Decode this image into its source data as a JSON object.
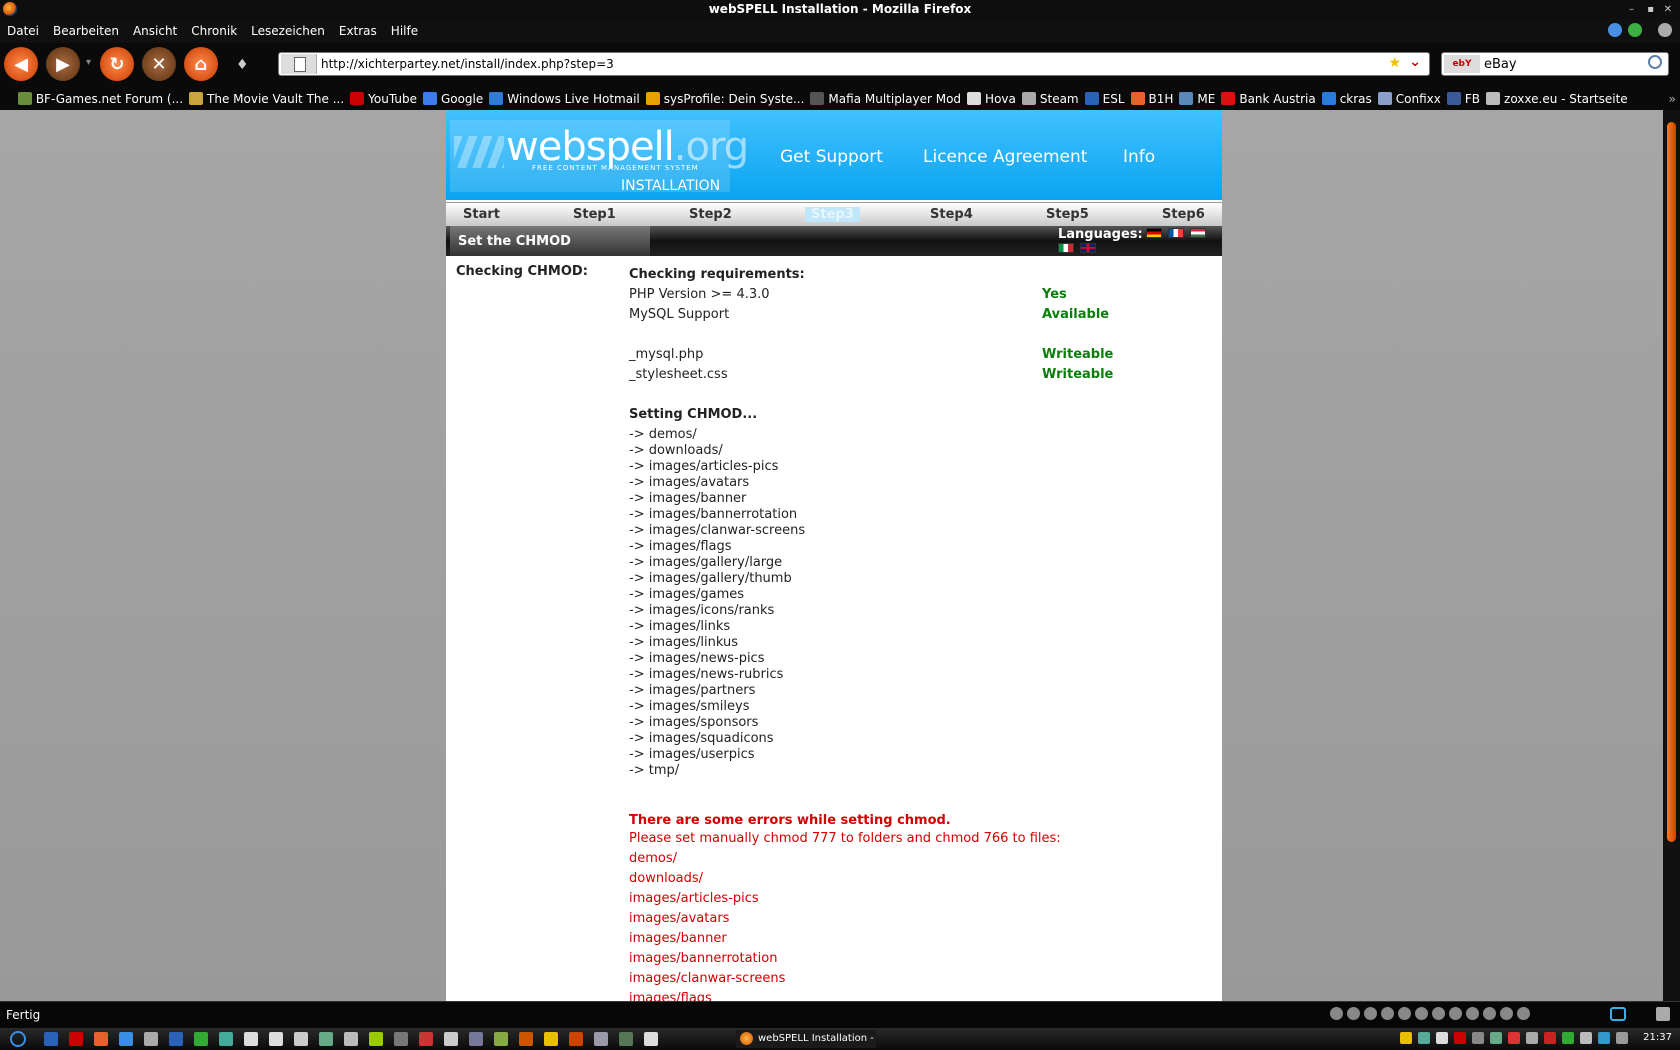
{
  "window": {
    "title": "webSPELL Installation - Mozilla Firefox"
  },
  "menu": [
    "Datei",
    "Bearbeiten",
    "Ansicht",
    "Chronik",
    "Lesezeichen",
    "Extras",
    "Hilfe"
  ],
  "toolbar": {
    "url": "http://xichterpartey.net/install/index.php?step=3",
    "search_value": "eBay",
    "search_engine": "ebY"
  },
  "bookmarks": [
    {
      "label": "BF-Games.net Forum (...",
      "color": "#6a8f3a"
    },
    {
      "label": "The Movie Vault The ...",
      "color": "#c9a53b"
    },
    {
      "label": "YouTube",
      "color": "#c00"
    },
    {
      "label": "Google",
      "color": "#3b7de9"
    },
    {
      "label": "Windows Live Hotmail",
      "color": "#2f7bd6"
    },
    {
      "label": "sysProfile: Dein Syste...",
      "color": "#e7a100"
    },
    {
      "label": "Mafia Multiplayer Mod",
      "color": "#555"
    },
    {
      "label": "Hova",
      "color": "#ddd"
    },
    {
      "label": "Steam",
      "color": "#aaa"
    },
    {
      "label": "ESL",
      "color": "#2a62b8"
    },
    {
      "label": "B1H",
      "color": "#e8602c"
    },
    {
      "label": "ME",
      "color": "#5a88b8"
    },
    {
      "label": "Bank Austria",
      "color": "#d11"
    },
    {
      "label": "ckras",
      "color": "#2a7be0"
    },
    {
      "label": "Confixx",
      "color": "#8aa0c8"
    },
    {
      "label": "FB",
      "color": "#3b5998"
    },
    {
      "label": "zoxxe.eu - Startseite",
      "color": "#bbb"
    }
  ],
  "site": {
    "logo_main": "webspell",
    "logo_org": ".org",
    "tagline": "FREE CONTENT MANAGEMENT SYSTEM",
    "subtitle": "INSTALLATION",
    "links": [
      "Get Support",
      "Licence Agreement",
      "Info"
    ],
    "steps": [
      "Start",
      "Step1",
      "Step2",
      "Step3",
      "Step4",
      "Step5",
      "Step6"
    ],
    "section_title": "Set the CHMOD",
    "languages_label": "Languages:"
  },
  "content": {
    "left_label": "Checking CHMOD:",
    "requirements_title": "Checking requirements:",
    "requirements": [
      {
        "name": "PHP Version >= 4.3.0",
        "status": "Yes"
      },
      {
        "name": "MySQL Support",
        "status": "Available"
      }
    ],
    "files": [
      {
        "name": "_mysql.php",
        "status": "Writeable"
      },
      {
        "name": "_stylesheet.css",
        "status": "Writeable"
      }
    ],
    "chmod_title": "Setting CHMOD...",
    "chmod_dirs": [
      "-> demos/",
      "-> downloads/",
      "-> images/articles-pics",
      "-> images/avatars",
      "-> images/banner",
      "-> images/bannerrotation",
      "-> images/clanwar-screens",
      "-> images/flags",
      "-> images/gallery/large",
      "-> images/gallery/thumb",
      "-> images/games",
      "-> images/icons/ranks",
      "-> images/links",
      "-> images/linkus",
      "-> images/news-pics",
      "-> images/news-rubrics",
      "-> images/partners",
      "-> images/smileys",
      "-> images/sponsors",
      "-> images/squadicons",
      "-> images/userpics",
      "-> tmp/"
    ],
    "error_title": "There are some errors while setting chmod.",
    "error_text": "Please set manually chmod 777 to folders and chmod 766 to files:",
    "error_dirs": [
      "demos/",
      "downloads/",
      "images/articles-pics",
      "images/avatars",
      "images/banner",
      "images/bannerrotation",
      "images/clanwar-screens",
      "images/flags"
    ]
  },
  "statusbar": {
    "text": "Fertig"
  },
  "taskbar": {
    "task_label": "webSPELL Installation - ...",
    "clock": "21:37"
  }
}
